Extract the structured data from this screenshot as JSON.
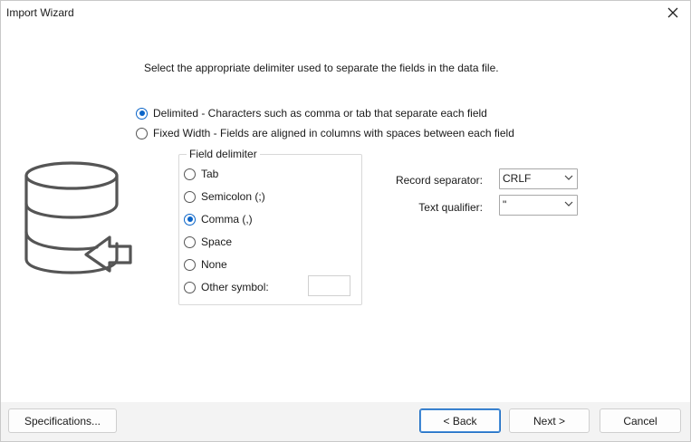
{
  "window": {
    "title": "Import Wizard"
  },
  "instruction": "Select the appropriate delimiter used to separate the fields in the data file.",
  "format_options": [
    {
      "label": "Delimited - Characters such as comma or tab that separate each field",
      "checked": true
    },
    {
      "label": "Fixed Width - Fields are aligned in columns with spaces between each field",
      "checked": false
    }
  ],
  "field_delimiter": {
    "legend": "Field delimiter",
    "options": [
      {
        "label": "Tab",
        "checked": false
      },
      {
        "label": "Semicolon (;)",
        "checked": false
      },
      {
        "label": "Comma (,)",
        "checked": true
      },
      {
        "label": "Space",
        "checked": false
      },
      {
        "label": "None",
        "checked": false
      },
      {
        "label": "Other symbol:",
        "checked": false
      }
    ],
    "other_symbol_value": ""
  },
  "record_separator": {
    "label": "Record separator:",
    "value": "CRLF"
  },
  "text_qualifier": {
    "label": "Text qualifier:",
    "value": "\""
  },
  "buttons": {
    "specifications": "Specifications...",
    "back": "< Back",
    "next": "Next >",
    "cancel": "Cancel"
  },
  "colors": {
    "accent": "#0a64c8",
    "icon": "#555555",
    "footer_bg": "#f3f3f3"
  },
  "icons": {
    "close": "close-icon",
    "database_import": "database-import-icon",
    "dropdown": "chevron-down-icon"
  }
}
